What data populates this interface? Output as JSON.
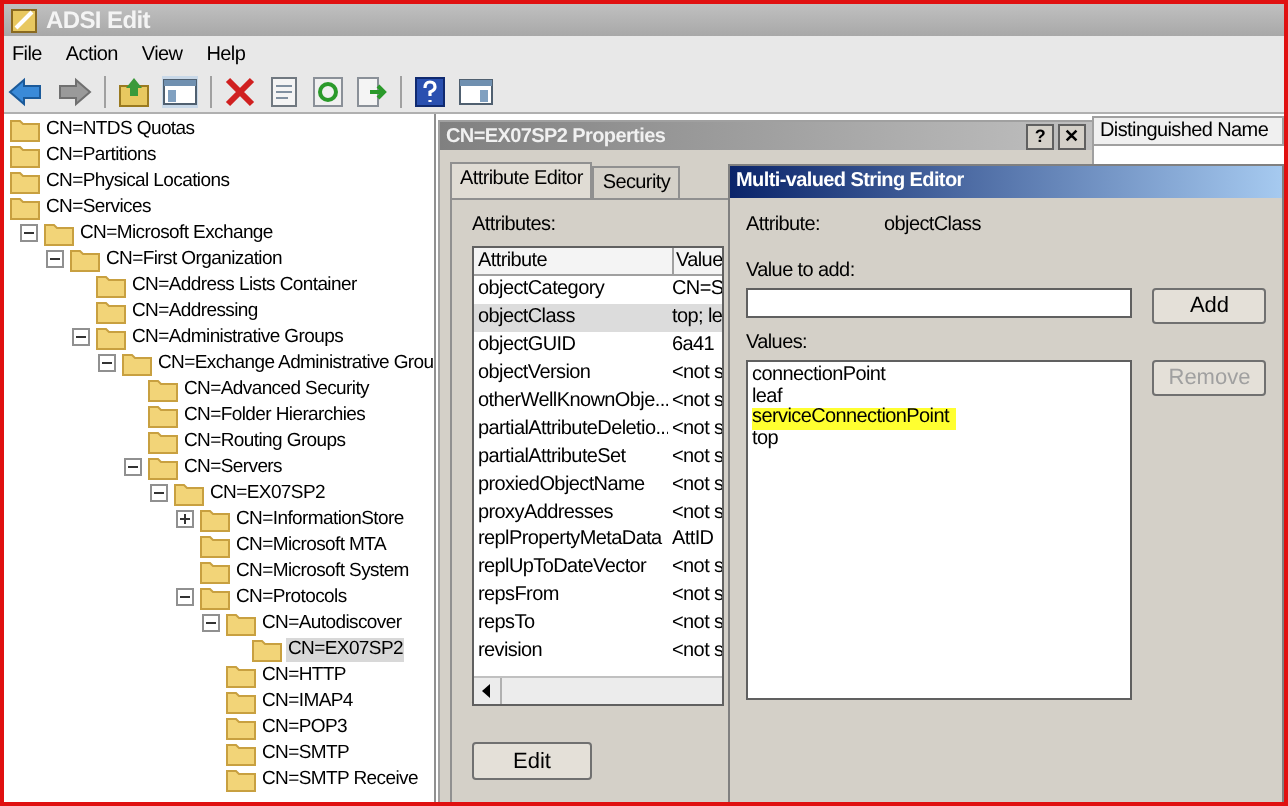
{
  "window": {
    "title": "ADSI Edit"
  },
  "menu": [
    "File",
    "Action",
    "View",
    "Help"
  ],
  "toolbar": [
    {
      "kind": "back"
    },
    {
      "kind": "forward"
    },
    {
      "kind": "sep"
    },
    {
      "kind": "up"
    },
    {
      "kind": "tree"
    },
    {
      "kind": "sep"
    },
    {
      "kind": "delete"
    },
    {
      "kind": "properties"
    },
    {
      "kind": "refresh"
    },
    {
      "kind": "export"
    },
    {
      "kind": "sep"
    },
    {
      "kind": "help"
    },
    {
      "kind": "panel"
    }
  ],
  "tree": [
    {
      "label": "CN=NTDS Quotas",
      "selected": false
    },
    {
      "label": "CN=Partitions",
      "selected": false
    },
    {
      "label": "CN=Physical Locations",
      "selected": false
    },
    {
      "label": "CN=Services",
      "selected": false
    },
    {
      "label": "CN=Microsoft Exchange",
      "selected": false,
      "expanded": true,
      "children": [
        {
          "label": "CN=First Organization",
          "selected": false,
          "expanded": true,
          "children": [
            {
              "label": "CN=Address Lists Container",
              "selected": false
            },
            {
              "label": "CN=Addressing",
              "selected": false
            },
            {
              "label": "CN=Administrative Groups",
              "selected": false,
              "expanded": true,
              "children": [
                {
                  "label": "CN=Exchange Administrative Grou",
                  "selected": false,
                  "expanded": true,
                  "children": [
                    {
                      "label": "CN=Advanced Security",
                      "selected": false
                    },
                    {
                      "label": "CN=Folder Hierarchies",
                      "selected": false
                    },
                    {
                      "label": "CN=Routing Groups",
                      "selected": false
                    },
                    {
                      "label": "CN=Servers",
                      "selected": false,
                      "expanded": true,
                      "children": [
                        {
                          "label": "CN=EX07SP2",
                          "selected": false,
                          "expanded": true,
                          "children": [
                            {
                              "label": "CN=InformationStore",
                              "selected": false,
                              "expanded": false
                            },
                            {
                              "label": "CN=Microsoft MTA",
                              "selected": false
                            },
                            {
                              "label": "CN=Microsoft System",
                              "selected": false
                            },
                            {
                              "label": "CN=Protocols",
                              "selected": false,
                              "expanded": true,
                              "children": [
                                {
                                  "label": "CN=Autodiscover",
                                  "selected": false,
                                  "expanded": true,
                                  "children": [
                                    {
                                      "label": "CN=EX07SP2",
                                      "selected": true
                                    }
                                  ]
                                },
                                {
                                  "label": "CN=HTTP",
                                  "selected": false
                                },
                                {
                                  "label": "CN=IMAP4",
                                  "selected": false
                                },
                                {
                                  "label": "CN=POP3",
                                  "selected": false
                                },
                                {
                                  "label": "CN=SMTP",
                                  "selected": false
                                },
                                {
                                  "label": "CN=SMTP Receive",
                                  "selected": false
                                }
                              ]
                            }
                          ]
                        }
                      ]
                    }
                  ]
                }
              ]
            }
          ]
        }
      ]
    }
  ],
  "list_header": "Distinguished Name",
  "properties": {
    "title": "CN=EX07SP2 Properties",
    "help_button": "?",
    "close_button": "✕",
    "tabs": [
      {
        "label": "Attribute Editor",
        "selected": true
      },
      {
        "label": "Security",
        "selected": false
      }
    ],
    "attributes_label": "Attributes:",
    "columns": [
      "Attribute",
      "Value"
    ],
    "rows": [
      {
        "attribute": "objectCategory",
        "value": "CN=S",
        "selected": false
      },
      {
        "attribute": "objectClass",
        "value": "top; le",
        "selected": true
      },
      {
        "attribute": "objectGUID",
        "value": "6a41",
        "selected": false
      },
      {
        "attribute": "objectVersion",
        "value": "<not s",
        "selected": false
      },
      {
        "attribute": "otherWellKnownObje...",
        "value": "<not s",
        "selected": false
      },
      {
        "attribute": "partialAttributeDeletio...",
        "value": "<not s",
        "selected": false
      },
      {
        "attribute": "partialAttributeSet",
        "value": "<not s",
        "selected": false
      },
      {
        "attribute": "proxiedObjectName",
        "value": "<not s",
        "selected": false
      },
      {
        "attribute": "proxyAddresses",
        "value": "<not s",
        "selected": false
      },
      {
        "attribute": "replPropertyMetaData",
        "value": "AttID",
        "selected": false
      },
      {
        "attribute": "replUpToDateVector",
        "value": "<not s",
        "selected": false
      },
      {
        "attribute": "repsFrom",
        "value": "<not s",
        "selected": false
      },
      {
        "attribute": "repsTo",
        "value": "<not s",
        "selected": false
      },
      {
        "attribute": "revision",
        "value": "<not s",
        "selected": false
      }
    ],
    "edit_button": "Edit"
  },
  "editor": {
    "title": "Multi-valued String Editor",
    "attribute_label": "Attribute:",
    "attribute_value": "objectClass",
    "value_to_add_label": "Value to add:",
    "add_button": "Add",
    "values_label": "Values:",
    "values": [
      {
        "text": "connectionPoint",
        "highlighted": false
      },
      {
        "text": "leaf",
        "highlighted": false
      },
      {
        "text": "serviceConnectionPoint",
        "highlighted": true
      },
      {
        "text": "top",
        "highlighted": false
      }
    ],
    "remove_button": {
      "label": "Remove",
      "disabled": true
    }
  }
}
